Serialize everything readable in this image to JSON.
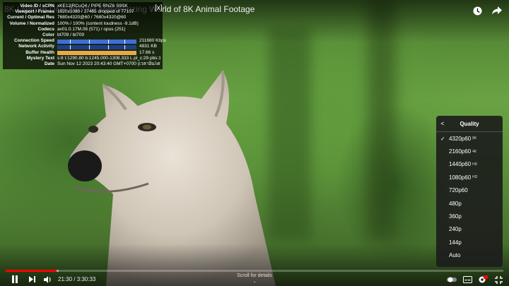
{
  "video": {
    "title": "8K | Nature Dive into the Mesmerizing World of 8K Animal Footage"
  },
  "stats": [
    {
      "label": "Video ID / sCPN",
      "value": "xKE12jRCuQ4 / PIPE RNZ6 S9SK"
    },
    {
      "label": "Viewport / Frames",
      "value": "1920x1080 / 27465 dropped of 77107"
    },
    {
      "label": "Current / Optimal Res",
      "value": "7680x4320@60 / 7680x4320@60"
    },
    {
      "label": "Volume / Normalized",
      "value": "100% / 100% (content loudness -9.1dB)"
    },
    {
      "label": "Codecs",
      "value": "av01.0.17M.08 (571) / opus (251)"
    },
    {
      "label": "Color",
      "value": "bt709 / bt709"
    },
    {
      "label": "Connection Speed",
      "value": "211680 Kbps",
      "bar": "conn"
    },
    {
      "label": "Network Activity",
      "value": "4831 KB",
      "bar": "net"
    },
    {
      "label": "Buffer Health",
      "value": "17.66 s",
      "bar": "buf"
    },
    {
      "label": "Mystery Text",
      "value": "s:8 t:1290.80 b:1245.000-1308.333 L pl_c:29 pbs:158"
    },
    {
      "label": "Date",
      "value": "Sun Nov 12 2023 20:43:40 GMT+0700 (เวลาอินโดจีน)"
    }
  ],
  "stats_close": "[x]",
  "quality_menu": {
    "title": "Quality",
    "back_glyph": "<",
    "items": [
      {
        "label": "4320p60",
        "badge": "8K",
        "selected": true
      },
      {
        "label": "2160p60",
        "badge": "4K",
        "selected": false
      },
      {
        "label": "1440p60",
        "badge": "HD",
        "selected": false
      },
      {
        "label": "1080p60",
        "badge": "HD",
        "selected": false
      },
      {
        "label": "720p60",
        "badge": "",
        "selected": false
      },
      {
        "label": "480p",
        "badge": "",
        "selected": false
      },
      {
        "label": "360p",
        "badge": "",
        "selected": false
      },
      {
        "label": "240p",
        "badge": "",
        "selected": false
      },
      {
        "label": "144p",
        "badge": "",
        "selected": false
      },
      {
        "label": "Auto",
        "badge": "",
        "selected": false
      }
    ]
  },
  "player": {
    "time_display": "21:30 / 3:30:33",
    "scroll_hint": "Scroll for details",
    "progress_played": 0.102,
    "progress_loaded": 0.106,
    "accent": "#ff0000"
  },
  "icons": {
    "watch_later": "clock-icon",
    "share": "share-icon",
    "play_pause": "pause-icon",
    "next": "next-icon",
    "volume": "volume-icon",
    "subtitles": "subtitles-icon",
    "settings": "gear-icon",
    "fullscreen_exit": "fullscreen-exit-icon"
  }
}
